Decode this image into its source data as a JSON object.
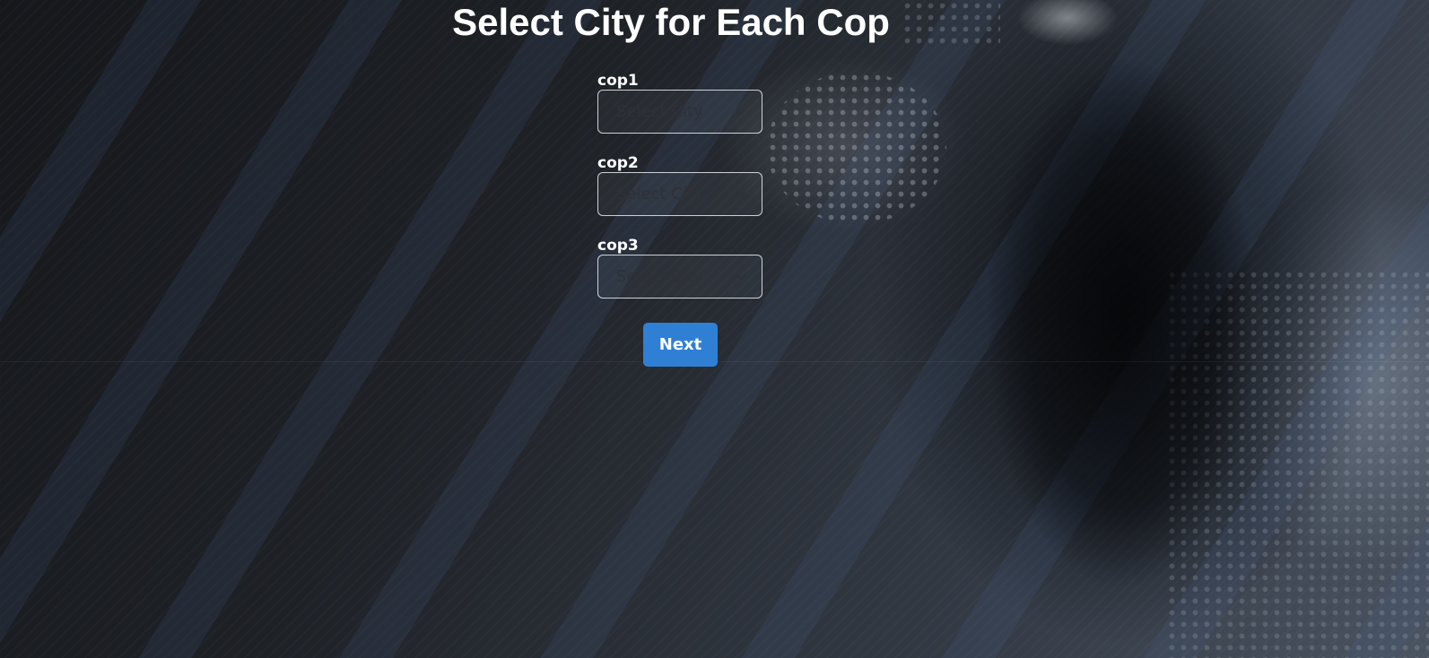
{
  "page": {
    "title": "Select City for Each Cop"
  },
  "form": {
    "fields": [
      {
        "label": "cop1",
        "placeholder": "Select City"
      },
      {
        "label": "cop2",
        "placeholder": "Select City"
      },
      {
        "label": "cop3",
        "placeholder": "Select City"
      }
    ],
    "next_label": "Next"
  },
  "icons": {
    "select_indicator": "chevron-down-icon"
  },
  "colors": {
    "primary_button": "#2f80d4",
    "text": "#ffffff",
    "select_placeholder": "#2e3137"
  }
}
